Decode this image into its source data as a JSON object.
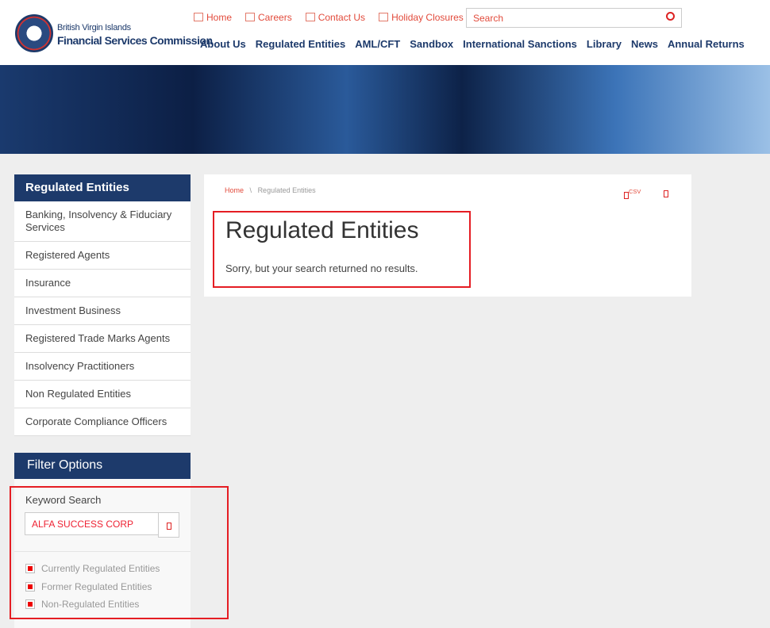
{
  "header": {
    "logo_line1": "British Virgin Islands",
    "logo_line2": "Financial Services Commission",
    "top_links": [
      "Home",
      "Careers",
      "Contact Us",
      "Holiday Closures"
    ],
    "search_placeholder": "Search",
    "nav": [
      "About Us",
      "Regulated Entities",
      "AML/CFT",
      "Sandbox",
      "International Sanctions",
      "Library",
      "News",
      "Annual Returns"
    ]
  },
  "sidebar": {
    "title": "Regulated Entities",
    "items": [
      "Banking, Insolvency & Fiduciary Services",
      "Registered Agents",
      "Insurance",
      "Investment Business",
      "Registered Trade Marks Agents",
      "Insolvency Practitioners",
      "Non Regulated Entities",
      "Corporate Compliance Officers"
    ]
  },
  "filter": {
    "title": "Filter Options",
    "keyword_label": "Keyword Search",
    "keyword_value": "ALFA SUCCESS CORP",
    "checkboxes": [
      "Currently Regulated Entities",
      "Former Regulated Entities",
      "Non-Regulated Entities"
    ]
  },
  "content": {
    "breadcrumb_home": "Home",
    "breadcrumb_sep": "\\",
    "breadcrumb_current": "Regulated Entities",
    "csv_label": "CSV",
    "title": "Regulated Entities",
    "message": "Sorry, but your search returned no results."
  }
}
